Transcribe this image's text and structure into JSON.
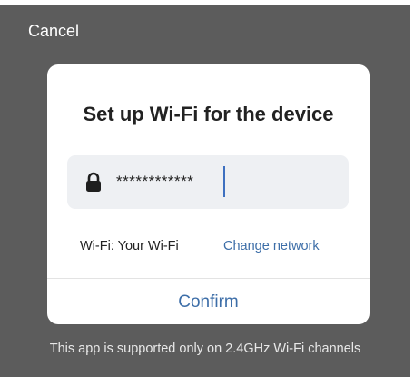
{
  "header": {
    "cancel_label": "Cancel"
  },
  "dialog": {
    "title": "Set up Wi-Fi for the device",
    "password_field": {
      "value": "************",
      "icon": "lock-icon"
    },
    "wifi_label": "Wi-Fi: Your Wi-Fi",
    "change_network_label": "Change network",
    "confirm_label": "Confirm"
  },
  "footer": {
    "note": "This app is supported only on 2.4GHz Wi-Fi channels"
  },
  "colors": {
    "overlay": "#5c5c5c",
    "accent": "#3d6ea8",
    "field_bg": "#eef0f3"
  }
}
